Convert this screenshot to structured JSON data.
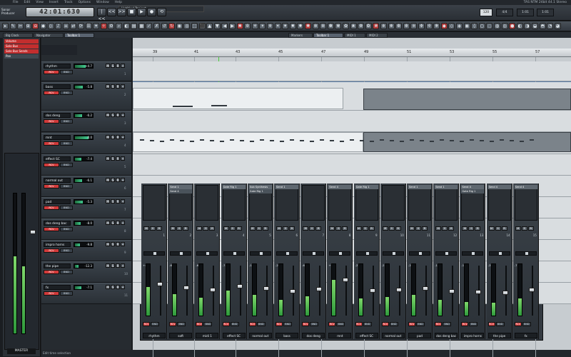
{
  "menubar": [
    "File",
    "Edit",
    "View",
    "Insert",
    "Track",
    "Options",
    "Window",
    "Help"
  ],
  "title_strip": "TAS NTM 24bit 44.1 Stereo",
  "logo": {
    "line1": "Sonar",
    "line2": "Producer"
  },
  "transport": {
    "time": "42:01:630",
    "buttons": [
      "|<<",
      "<<",
      ">>",
      "■",
      "▶",
      "●",
      "⟲"
    ]
  },
  "project_name": "Untitled Project",
  "right_readouts": {
    "bpm": "120",
    "box2": "4/4",
    "box3": "1:01",
    "box4": "1:01"
  },
  "tabs": [
    {
      "label": "Big Clock",
      "on": false
    },
    {
      "label": "Navigator",
      "on": false
    },
    {
      "label": "Toolbar 1",
      "on": true
    },
    {
      "label": "Markers",
      "on": false
    },
    {
      "label": "Toolbar 1",
      "on": true
    },
    {
      "label": "MIDI 1",
      "on": false
    },
    {
      "label": "MIDI 2",
      "on": false
    }
  ],
  "left_panel": {
    "items": [
      {
        "label": "Volume",
        "color": "#c22e2e"
      },
      {
        "label": "Solo Bus",
        "color": "#c22e2e"
      },
      {
        "label": "Solo Bus Sends",
        "color": "#c22e2e"
      },
      {
        "label": "Pan",
        "color": "#3f4850"
      }
    ],
    "master_label": "MASTER",
    "meter_levels": [
      0.55,
      0.48
    ]
  },
  "tracks": [
    {
      "name": "rhythm",
      "vol": "+4.7",
      "num": "1",
      "fill": 0.62
    },
    {
      "name": "bass",
      "vol": "-5.8",
      "num": "2",
      "fill": 0.45
    },
    {
      "name": "dos deng",
      "vol": "-6.2",
      "num": "3",
      "fill": 0.42
    },
    {
      "name": "mnt",
      "vol": "0.0",
      "num": "4",
      "fill": 0.78
    },
    {
      "name": "effect SC",
      "vol": "-7.4",
      "num": "5",
      "fill": 0.38
    },
    {
      "name": "normal out",
      "vol": "-6.1",
      "num": "6",
      "fill": 0.4
    },
    {
      "name": "pad",
      "vol": "-5.3",
      "num": "7",
      "fill": 0.44
    },
    {
      "name": "dos deng bac",
      "vol": "-8.0",
      "num": "8",
      "fill": 0.35
    },
    {
      "name": "impro horns",
      "vol": "-9.8",
      "num": "9",
      "fill": 0.28
    },
    {
      "name": "the pipe",
      "vol": "-12.3",
      "num": "10",
      "fill": 0.22
    },
    {
      "name": "fx",
      "vol": "-7.1",
      "num": "11",
      "fill": 0.36
    }
  ],
  "track_state": {
    "s1": "RCV",
    "s2": "BND"
  },
  "ruler_bars": [
    "39",
    "41",
    "43",
    "45",
    "47",
    "49",
    "51",
    "53",
    "55",
    "57"
  ],
  "mixer": {
    "title": "Mixer",
    "channels": [
      {
        "name": "rhythm",
        "ins": "",
        "ins2": "",
        "db": "+4.7",
        "level": 0.55
      },
      {
        "name": "soft",
        "ins": "Send 1",
        "ins2": "Send 4",
        "db": "-6.1",
        "level": 0.42
      },
      {
        "name": "midi 1",
        "ins": "",
        "ins2": "",
        "db": "-6.8",
        "level": 0.35
      },
      {
        "name": "effect SC",
        "ins": "Gate Rig 1",
        "ins2": "",
        "db": "-7.4",
        "level": 0.48
      },
      {
        "name": "normal out",
        "ins": "Sub Synthesis",
        "ins2": "Gate Rig 1",
        "db": "-13.2",
        "level": 0.4
      },
      {
        "name": "bass",
        "ins": "Send 1",
        "ins2": "",
        "db": "-20.0",
        "level": 0.3
      },
      {
        "name": "dos deng",
        "ins": "",
        "ins2": "",
        "db": "-6.2",
        "level": 0.38
      },
      {
        "name": "mnt",
        "ins": "Send 4",
        "ins2": "",
        "db": "+0.1",
        "level": 0.7
      },
      {
        "name": "effect SC",
        "ins": "Gate Rig 1",
        "ins2": "",
        "db": "-27.6",
        "level": 0.33
      },
      {
        "name": "normal out",
        "ins": "",
        "ins2": "",
        "db": "-22.3",
        "level": 0.36
      },
      {
        "name": "pad",
        "ins": "Send 1",
        "ins2": "",
        "db": "-21.3",
        "level": 0.4
      },
      {
        "name": "dos deng bac",
        "ins": "Send 1",
        "ins2": "",
        "db": "-14.7",
        "level": 0.3
      },
      {
        "name": "impro horns",
        "ins": "Send 4",
        "ins2": "Gate Rig 1",
        "db": "-15.8",
        "level": 0.27
      },
      {
        "name": "the pipe",
        "ins": "Send 4",
        "ins2": "",
        "db": "-25.2",
        "level": 0.25
      },
      {
        "name": "fx",
        "ins": "Send 4",
        "ins2": "",
        "db": "-7.1",
        "level": 0.34
      }
    ]
  },
  "status_text": "Edit time selection"
}
